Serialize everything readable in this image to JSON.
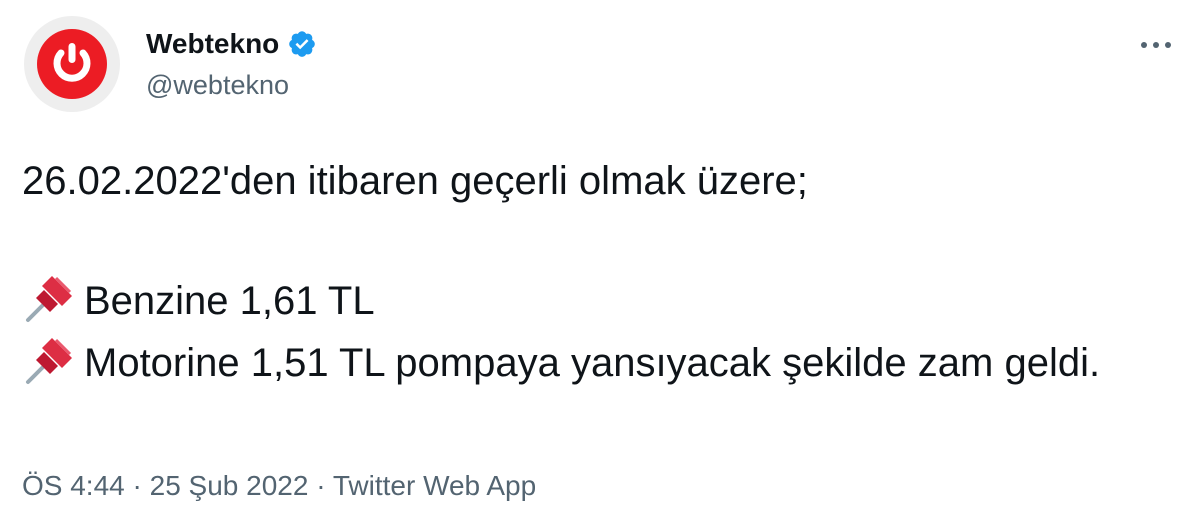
{
  "author": {
    "display_name": "Webtekno",
    "handle": "@webtekno",
    "verified": true,
    "avatar_icon": "power-button-logo",
    "brand_color": "#ec1c24",
    "verified_color": "#1d9bf0"
  },
  "tweet": {
    "line_1": "26.02.2022'den itibaren geçerli olmak üzere;",
    "line_2": "Benzine 1,61 TL",
    "line_3": "Motorine 1,51 TL pompaya yansıyacak şekilde zam geldi.",
    "bullet_icon": "pushpin-icon"
  },
  "meta": {
    "time": "ÖS 4:44",
    "separator": "·",
    "date": "25 Şub 2022",
    "source": "Twitter Web App"
  },
  "more_icon": "more-horizontal-icon"
}
